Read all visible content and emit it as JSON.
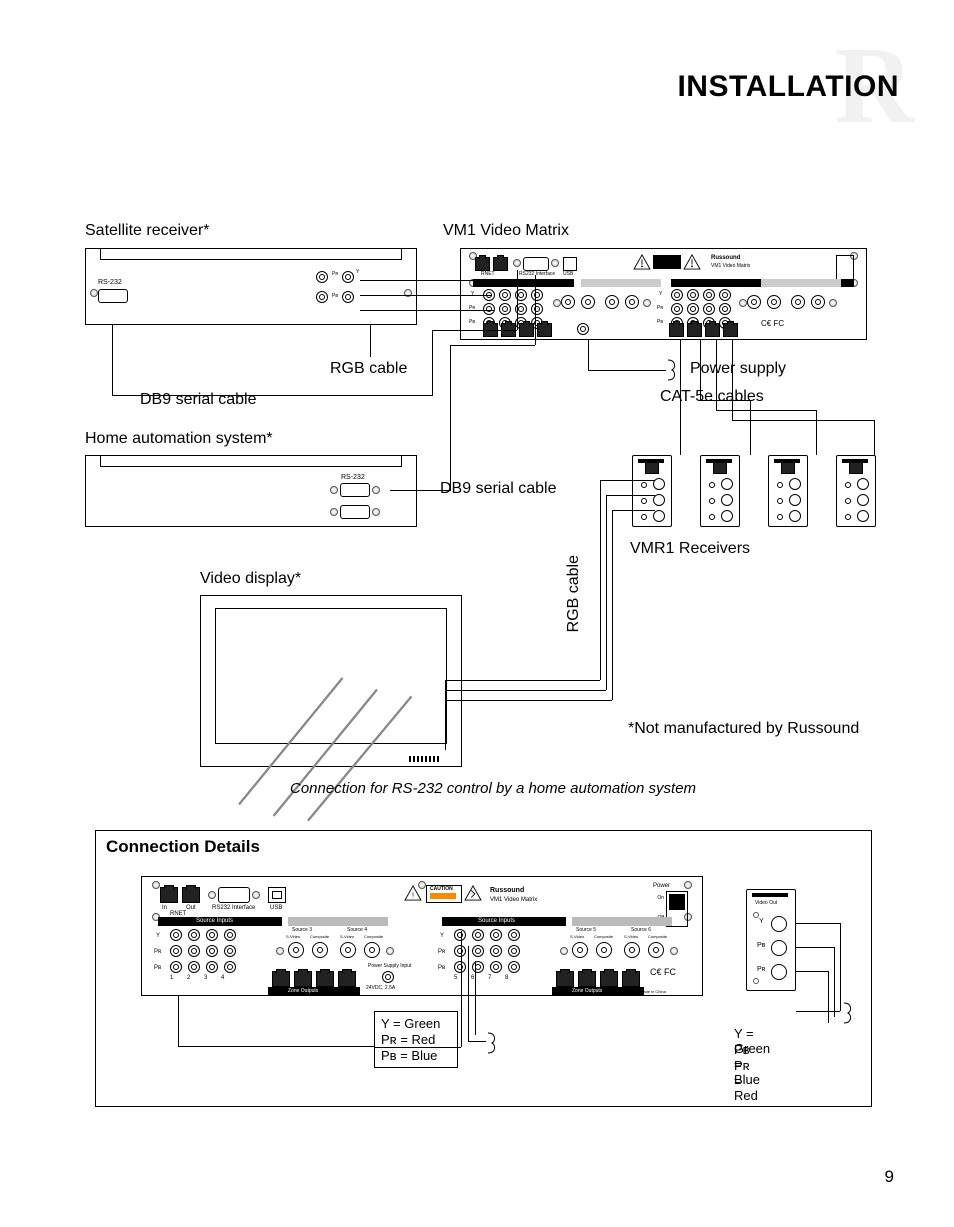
{
  "header": {
    "section_title": "INSTALLATION",
    "watermark_letter": "R"
  },
  "diagram1": {
    "satellite_receiver_label": "Satellite receiver*",
    "vm1_label": "VM1 Video Matrix",
    "rgb_cable_label": "RGB cable",
    "db9_serial_cable_label": "DB9 serial cable",
    "power_supply_label": "Power supply",
    "cat5e_label": "CAT-5e cables",
    "home_automation_label": "Home automation system*",
    "db9_serial_cable_label_2": "DB9 serial cable",
    "vmr1_receivers_label": "VMR1 Receivers",
    "video_display_label": "Video display*",
    "rgb_cable_vert_label": "RGB cable",
    "footnote": "*Not manufactured by Russound",
    "caption": "Connection for RS-232 control by a home automation system",
    "sat_rs232_label": "RS-232",
    "brand_label": "Russound",
    "vm1_product_label": "VM1 Video Matrix",
    "source_inputs_label": "Source Inputs",
    "zone_outputs_label": "Zone Outputs",
    "rnet_label": "RNET",
    "rs232_interface_label": "RS232 Interface",
    "usb_label": "USB",
    "power_switch_on": "On",
    "power_switch_off": "Off",
    "y_label": "Y",
    "pr_label": "Pʀ",
    "pb_label": "Pʙ",
    "video_out_label": "Video Out"
  },
  "panel": {
    "title": "Connection Details",
    "legend1": {
      "y": "Y = Green",
      "pr": "Pʀ = Red",
      "pb": "Pʙ = Blue"
    },
    "legend2": {
      "y": "Y = Green",
      "pb": "Pʙ = Blue",
      "pr": "Pʀ = Red"
    },
    "power_supply_input": "Power Supply Input",
    "power_rating": "24VDC, 2.5A",
    "source3": "Source 3",
    "source4": "Source 4",
    "source5": "Source 5",
    "source6": "Source 6",
    "svideo": "S-Video",
    "composite": "Composite",
    "caution": "CAUTION",
    "designed": "Designed in the USA  Made in China",
    "numbers_1_4": "1        2       3       4",
    "numbers_5_8": "5        6       7       8",
    "in_label": "In",
    "out_label": "Out"
  },
  "footer": {
    "page_number": "9"
  }
}
